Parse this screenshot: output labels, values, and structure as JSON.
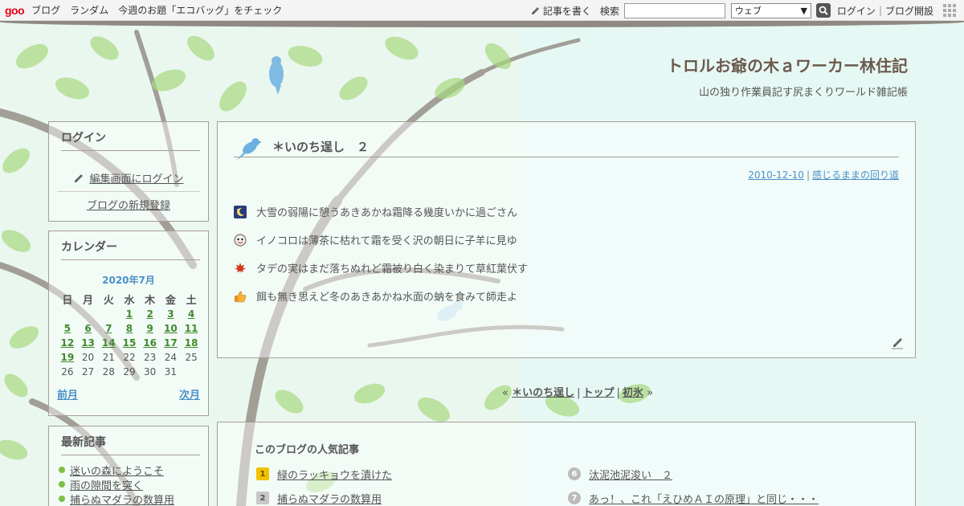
{
  "topbar": {
    "logo": "goo",
    "nav": [
      "ブログ",
      "ランダム",
      "今週のお題「エコバッグ」をチェック"
    ],
    "write_label": "記事を書く",
    "search_label": "検索",
    "search_placeholder": "",
    "search_scope": "ウェブ",
    "login": "ログイン",
    "open_blog": "ブログ開設"
  },
  "blog": {
    "title": "トロルお爺の木ａワーカー林住記",
    "description": "山の独り作業員記す尻まくりワールド雑記帳"
  },
  "login_panel": {
    "title": "ログイン",
    "edit_login": "編集画面にログイン",
    "register": "ブログの新規登録"
  },
  "calendar": {
    "title": "カレンダー",
    "month": "2020年7月",
    "weekdays": [
      "日",
      "月",
      "火",
      "水",
      "木",
      "金",
      "土"
    ],
    "weeks": [
      [
        {
          "d": ""
        },
        {
          "d": ""
        },
        {
          "d": ""
        },
        {
          "d": "1",
          "link": true
        },
        {
          "d": "2",
          "link": true
        },
        {
          "d": "3",
          "link": true
        },
        {
          "d": "4",
          "link": true
        }
      ],
      [
        {
          "d": "5",
          "link": true
        },
        {
          "d": "6",
          "link": true
        },
        {
          "d": "7",
          "link": true
        },
        {
          "d": "8",
          "link": true
        },
        {
          "d": "9",
          "link": true
        },
        {
          "d": "10",
          "link": true
        },
        {
          "d": "11",
          "link": true
        }
      ],
      [
        {
          "d": "12",
          "link": true
        },
        {
          "d": "13",
          "link": true
        },
        {
          "d": "14",
          "link": true
        },
        {
          "d": "15",
          "link": true
        },
        {
          "d": "16",
          "link": true
        },
        {
          "d": "17",
          "link": true
        },
        {
          "d": "18",
          "link": true
        }
      ],
      [
        {
          "d": "19",
          "link": true
        },
        {
          "d": "20"
        },
        {
          "d": "21"
        },
        {
          "d": "22"
        },
        {
          "d": "23"
        },
        {
          "d": "24"
        },
        {
          "d": "25"
        }
      ],
      [
        {
          "d": "26"
        },
        {
          "d": "27"
        },
        {
          "d": "28"
        },
        {
          "d": "29"
        },
        {
          "d": "30"
        },
        {
          "d": "31"
        },
        {
          "d": ""
        }
      ]
    ],
    "prev": "前月",
    "next": "次月"
  },
  "recent": {
    "title": "最新記事",
    "items": [
      "迷いの森にようこそ",
      "雨の隙間を突く",
      "捕らぬマダラの数算用"
    ]
  },
  "article": {
    "title": "＊いのち逞し　２",
    "date": "2010-12-10",
    "category": "感じるままの回り道",
    "lines": [
      {
        "icon": "night-moon-icon",
        "text": "大雪の弱陽に憩うあきあかね霜降る幾度いかに過ごさん"
      },
      {
        "icon": "face-icon",
        "text": "イノコロは薄茶に枯れて霜を受く沢の朝日に子羊に見ゆ"
      },
      {
        "icon": "maple-leaf-icon",
        "text": "タデの実はまだ落ちぬれど霜被り白く染まりて草紅葉伏す"
      },
      {
        "icon": "thumbs-up-icon",
        "text": "餌も無き思えど冬のあきあかね水面の蚋を食みて師走よ"
      }
    ]
  },
  "pager": {
    "prev_arrow": "«",
    "prev": "＊いのち逞し",
    "top": "トップ",
    "next": "初氷",
    "next_arrow": "»"
  },
  "popular": {
    "title": "このブログの人気記事",
    "left": [
      {
        "rank": "1",
        "text": "緑のラッキョウを漬けた"
      },
      {
        "rank": "2",
        "text": "捕らぬマダラの数算用"
      }
    ],
    "right": [
      {
        "rank": "6",
        "text": "汰泥池泥浚い　２"
      },
      {
        "rank": "7",
        "text": "あっ！、これ「えひめＡＩの原理」と同じ・・・"
      }
    ]
  }
}
